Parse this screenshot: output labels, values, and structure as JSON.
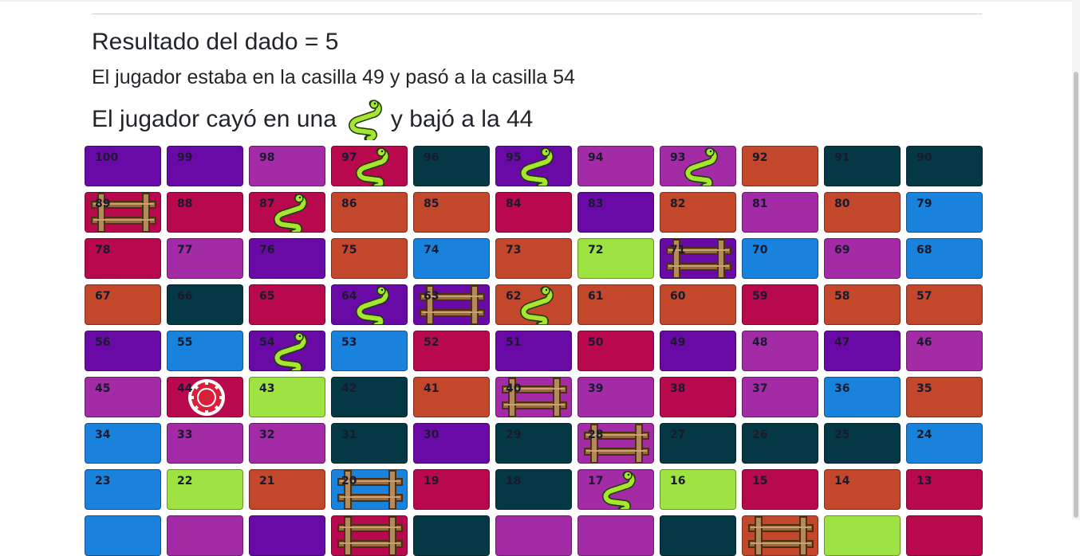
{
  "header": {
    "dice_result": "Resultado del dado = 5",
    "move_text": "El jugador estaba en la casilla 49 y pasó a la casilla 54",
    "fall_prefix": "El jugador cayó en una",
    "fall_icon": "snake-icon",
    "fall_suffix": "y bajó a la 44"
  },
  "colors": {
    "purple": "#6a0aa6",
    "magenta": "#a32ba6",
    "crimson": "#b8094f",
    "orange": "#c2472b",
    "teal": "#053845",
    "blue": "#1882dc",
    "green": "#9ee341"
  },
  "board": {
    "rows": [
      [
        {
          "n": "100",
          "c": "purple"
        },
        {
          "n": "99",
          "c": "purple"
        },
        {
          "n": "98",
          "c": "magenta"
        },
        {
          "n": "97",
          "c": "crimson",
          "icon": "snake"
        },
        {
          "n": "96",
          "c": "teal"
        },
        {
          "n": "95",
          "c": "purple",
          "icon": "snake"
        },
        {
          "n": "94",
          "c": "magenta"
        },
        {
          "n": "93",
          "c": "magenta",
          "icon": "snake"
        },
        {
          "n": "92",
          "c": "orange"
        },
        {
          "n": "91",
          "c": "teal"
        },
        {
          "n": "90",
          "c": "teal"
        }
      ],
      [
        {
          "n": "89",
          "c": "crimson",
          "icon": "ladder"
        },
        {
          "n": "88",
          "c": "crimson"
        },
        {
          "n": "87",
          "c": "crimson",
          "icon": "snake"
        },
        {
          "n": "86",
          "c": "orange"
        },
        {
          "n": "85",
          "c": "orange"
        },
        {
          "n": "84",
          "c": "crimson"
        },
        {
          "n": "83",
          "c": "purple"
        },
        {
          "n": "82",
          "c": "orange"
        },
        {
          "n": "81",
          "c": "magenta"
        },
        {
          "n": "80",
          "c": "orange"
        },
        {
          "n": "79",
          "c": "blue"
        }
      ],
      [
        {
          "n": "78",
          "c": "crimson"
        },
        {
          "n": "77",
          "c": "magenta"
        },
        {
          "n": "76",
          "c": "purple"
        },
        {
          "n": "75",
          "c": "orange"
        },
        {
          "n": "74",
          "c": "blue"
        },
        {
          "n": "73",
          "c": "orange"
        },
        {
          "n": "72",
          "c": "green"
        },
        {
          "n": "71",
          "c": "purple",
          "icon": "ladder"
        },
        {
          "n": "70",
          "c": "blue"
        },
        {
          "n": "69",
          "c": "magenta"
        },
        {
          "n": "68",
          "c": "blue"
        }
      ],
      [
        {
          "n": "67",
          "c": "orange"
        },
        {
          "n": "66",
          "c": "teal"
        },
        {
          "n": "65",
          "c": "crimson"
        },
        {
          "n": "64",
          "c": "purple",
          "icon": "snake"
        },
        {
          "n": "63",
          "c": "purple",
          "icon": "ladder"
        },
        {
          "n": "62",
          "c": "orange",
          "icon": "snake"
        },
        {
          "n": "61",
          "c": "orange"
        },
        {
          "n": "60",
          "c": "orange"
        },
        {
          "n": "59",
          "c": "crimson"
        },
        {
          "n": "58",
          "c": "orange"
        },
        {
          "n": "57",
          "c": "orange"
        }
      ],
      [
        {
          "n": "56",
          "c": "purple"
        },
        {
          "n": "55",
          "c": "blue"
        },
        {
          "n": "54",
          "c": "purple",
          "icon": "snake"
        },
        {
          "n": "53",
          "c": "blue"
        },
        {
          "n": "52",
          "c": "crimson"
        },
        {
          "n": "51",
          "c": "purple"
        },
        {
          "n": "50",
          "c": "crimson"
        },
        {
          "n": "49",
          "c": "purple"
        },
        {
          "n": "48",
          "c": "magenta"
        },
        {
          "n": "47",
          "c": "purple"
        },
        {
          "n": "46",
          "c": "magenta"
        }
      ],
      [
        {
          "n": "45",
          "c": "magenta"
        },
        {
          "n": "44",
          "c": "crimson",
          "icon": "chip"
        },
        {
          "n": "43",
          "c": "green"
        },
        {
          "n": "42",
          "c": "teal"
        },
        {
          "n": "41",
          "c": "orange"
        },
        {
          "n": "40",
          "c": "magenta",
          "icon": "ladder"
        },
        {
          "n": "39",
          "c": "magenta"
        },
        {
          "n": "38",
          "c": "crimson"
        },
        {
          "n": "37",
          "c": "magenta"
        },
        {
          "n": "36",
          "c": "blue"
        },
        {
          "n": "35",
          "c": "orange"
        }
      ],
      [
        {
          "n": "34",
          "c": "blue"
        },
        {
          "n": "33",
          "c": "magenta"
        },
        {
          "n": "32",
          "c": "magenta"
        },
        {
          "n": "31",
          "c": "teal"
        },
        {
          "n": "30",
          "c": "purple"
        },
        {
          "n": "29",
          "c": "teal"
        },
        {
          "n": "28",
          "c": "magenta",
          "icon": "ladder"
        },
        {
          "n": "27",
          "c": "teal"
        },
        {
          "n": "26",
          "c": "teal"
        },
        {
          "n": "25",
          "c": "teal"
        },
        {
          "n": "24",
          "c": "blue"
        }
      ],
      [
        {
          "n": "23",
          "c": "blue"
        },
        {
          "n": "22",
          "c": "green"
        },
        {
          "n": "21",
          "c": "orange"
        },
        {
          "n": "20",
          "c": "blue",
          "icon": "ladder"
        },
        {
          "n": "19",
          "c": "crimson"
        },
        {
          "n": "18",
          "c": "teal"
        },
        {
          "n": "17",
          "c": "magenta",
          "icon": "snake"
        },
        {
          "n": "16",
          "c": "green"
        },
        {
          "n": "15",
          "c": "crimson"
        },
        {
          "n": "14",
          "c": "orange"
        },
        {
          "n": "13",
          "c": "crimson"
        }
      ],
      [
        {
          "n": "",
          "c": "blue"
        },
        {
          "n": "",
          "c": "magenta"
        },
        {
          "n": "",
          "c": "purple"
        },
        {
          "n": "",
          "c": "crimson",
          "icon": "ladder"
        },
        {
          "n": "",
          "c": "teal"
        },
        {
          "n": "",
          "c": "magenta"
        },
        {
          "n": "",
          "c": "magenta"
        },
        {
          "n": "",
          "c": "teal"
        },
        {
          "n": "",
          "c": "orange",
          "icon": "ladder"
        },
        {
          "n": "",
          "c": "green"
        },
        {
          "n": "",
          "c": "crimson"
        }
      ]
    ]
  }
}
